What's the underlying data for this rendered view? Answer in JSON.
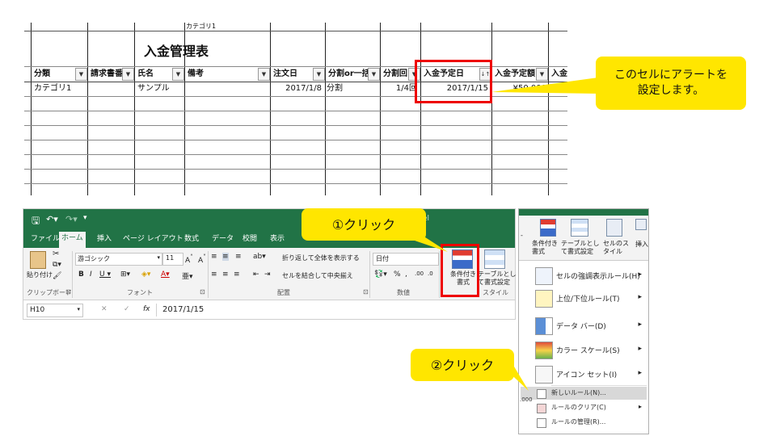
{
  "sheet": {
    "top_cell": "カテゴリ1",
    "title": "入金管理表",
    "headers": [
      "分類",
      "請求書番",
      "氏名",
      "備考",
      "注文日",
      "分割or一括",
      "分割回",
      "入金予定日",
      "入金予定額",
      "入金"
    ],
    "row": {
      "category": "カテゴリ1",
      "name": "サンプル",
      "order_date": "2017/1/8",
      "split": "分割",
      "count": "1/4回",
      "due_date": "2017/1/15",
      "amount": "¥50,000"
    }
  },
  "callouts": {
    "alert": "このセルにアラートを設定します。",
    "click1": "①クリック",
    "click2": "②クリック"
  },
  "ribbon": {
    "app_title": "el",
    "tabs": [
      "ファイル",
      "ホーム",
      "挿入",
      "ページ レイアウト",
      "数式",
      "データ",
      "校閲",
      "表示"
    ],
    "paste": "貼り付け",
    "font_name": "游ゴシック",
    "font_size": "11",
    "wrap_text": "折り返して全体を表示する",
    "merge_center": "セルを結合して中央揃え",
    "number_format": "日付",
    "percent": "%",
    "cond_format": "条件付き書式",
    "table_format": "テーブルとして書式設定",
    "groups": {
      "clipboard": "クリップボード",
      "font": "フォント",
      "alignment": "配置",
      "number": "数値",
      "style": "スタイル"
    },
    "name_box": "H10",
    "fx": "fx",
    "formula": "2017/1/15"
  },
  "menu": {
    "top_buttons": [
      "条件付き書式",
      "テーブルとして書式設定",
      "セルのスタイル",
      "挿入"
    ],
    "items": [
      "セルの強調表示ルール(H)",
      "上位/下位ルール(T)",
      "データ バー(D)",
      "カラー スケール(S)",
      "アイコン セット(I)"
    ],
    "sub_items": [
      "新しいルール(N)...",
      "ルールのクリア(C)",
      "ルールの管理(R)..."
    ],
    "side_value": ".000"
  },
  "colors": {
    "excel_green": "#217346",
    "callout_yellow": "#ffe600",
    "highlight_red": "#e00000"
  }
}
